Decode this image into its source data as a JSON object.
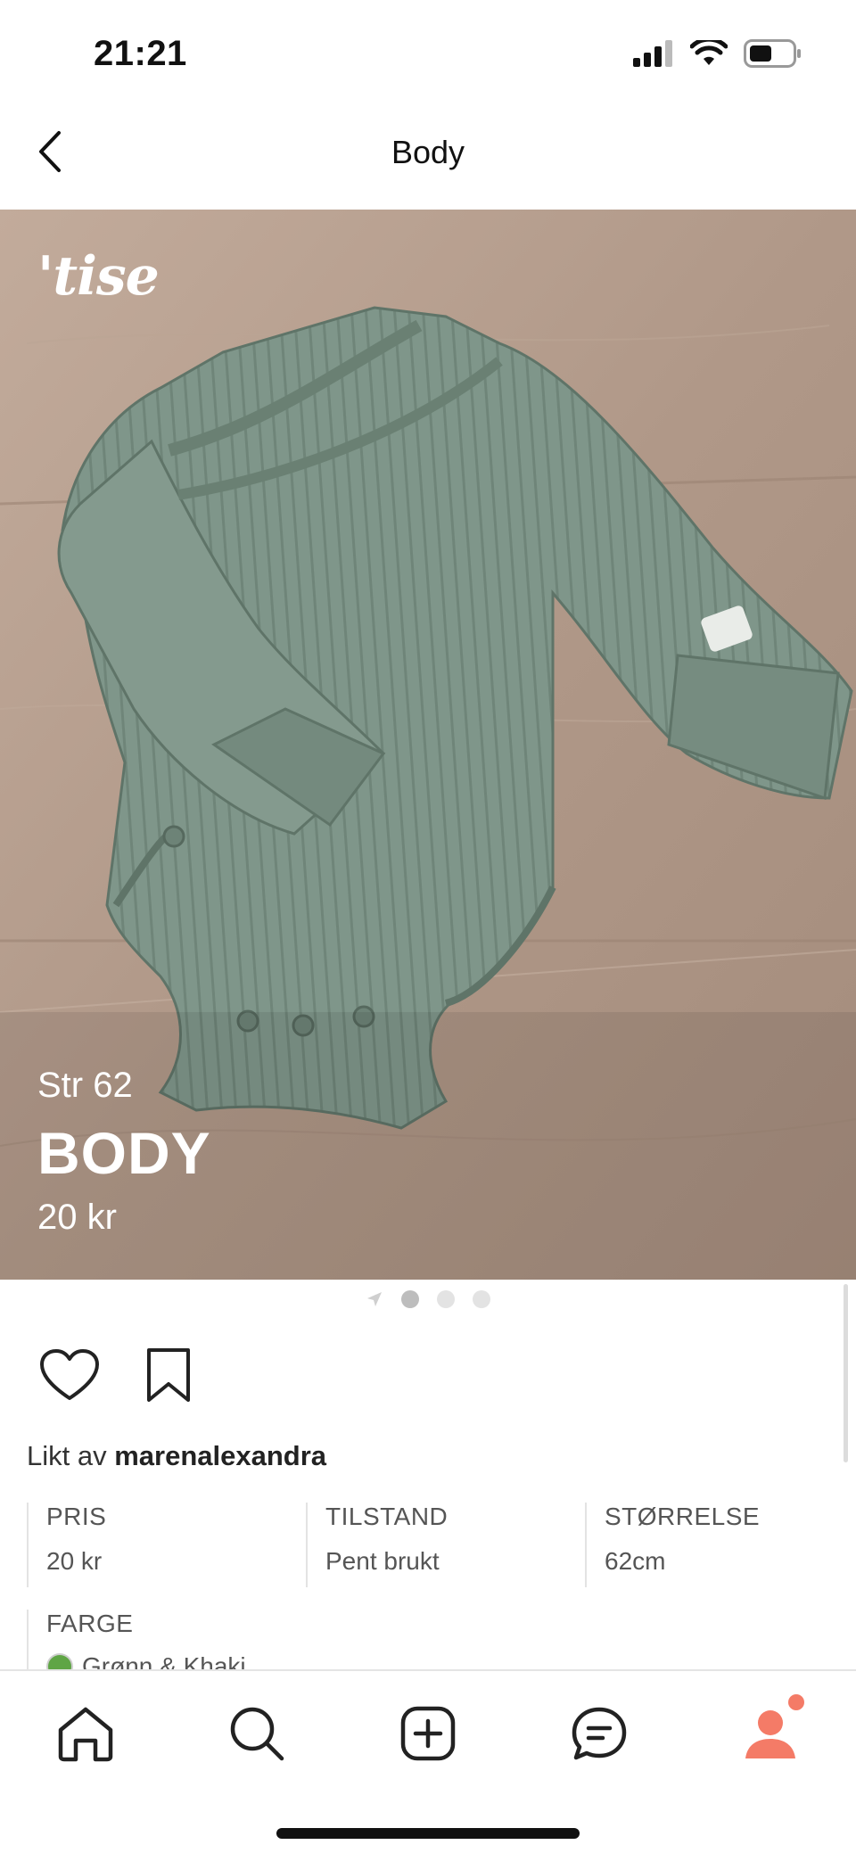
{
  "status_bar": {
    "time": "21:21"
  },
  "header": {
    "title": "Body",
    "back_icon": "chevron-left-icon"
  },
  "product": {
    "brand_logo": "'tise",
    "size_text": "Str 62",
    "title": "BODY",
    "price_text": "20 kr",
    "image_description_colors": {
      "wood": "#b39b8b",
      "garment": "#7d9488"
    }
  },
  "gallery": {
    "current_page": 1,
    "dots": [
      "location-arrow-icon",
      "dot",
      "dot",
      "dot"
    ]
  },
  "actions": {
    "like_icon": "heart-icon",
    "save_icon": "bookmark-icon"
  },
  "liked_by": {
    "prefix": "Likt av",
    "user": "marenalexandra"
  },
  "attributes": [
    {
      "label": "PRIS",
      "value": "20 kr"
    },
    {
      "label": "TILSTAND",
      "value": "Pent brukt"
    },
    {
      "label": "STØRRELSE",
      "value": "62cm"
    },
    {
      "label": "FARGE",
      "value": "Grønn & Khaki"
    }
  ],
  "tab_bar": {
    "items": [
      "home-icon",
      "search-icon",
      "add-icon",
      "chat-icon",
      "profile-icon"
    ],
    "accent": "#f47b67"
  }
}
